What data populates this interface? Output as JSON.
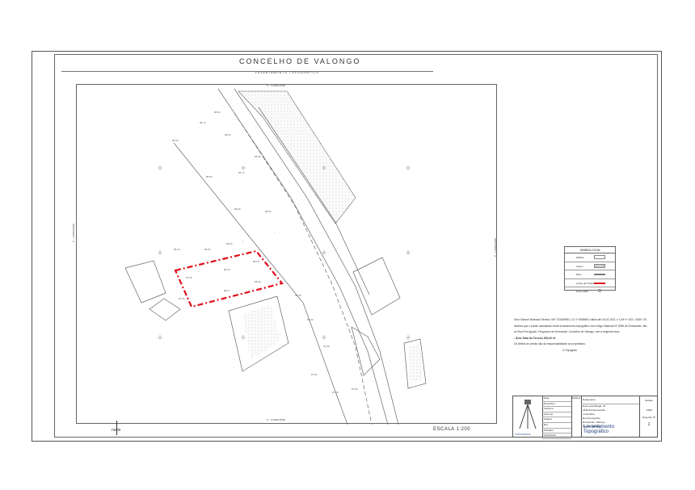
{
  "header": {
    "title": "CONCELHO DE VALONGO",
    "subtitle": "LEVANTAMENTO TOPOGRÁFICO"
  },
  "map": {
    "coord_top": "P - 1 (0000.0000)",
    "coord_bottom": "P - 1 (0000.0000)",
    "coord_left": "P - 1 (0000.0000)",
    "coord_right": "P - 1 (0000.0000)",
    "north_label": "norte",
    "scale_label": "ESCALA 1:200",
    "line_color": "#777777",
    "property_color": "#e0101a"
  },
  "legend": {
    "title": "SIMBOLOGIA",
    "items": [
      {
        "label": "Edifício"
      },
      {
        "label": "Anexo"
      },
      {
        "label": "Muro"
      },
      {
        "label": "Limite de Propriedade"
      },
      {
        "label": "Ponto EDP"
      }
    ]
  },
  "notes": {
    "line1": "Artur Manuel Barbosa Teixeira, NIF 233045984, CC nº 6555891 válido até 04.02.2021, e CAP nº 301 / 3308 / 09,",
    "line2": "declara que o prédio assinalado neste levantamento topográfico com Artigo Matricial Nº 5098 de Ermesinde, situ-",
    "line3": "ao Rua Frei Agosto, Freguesia de Ermesinde, Concelho de Valongo, tem a seguinte área:",
    "line4": "- Área Total do Terreno 200,00 m²",
    "line5": "Os limites do prédio são da responsabilidade do proprietário.",
    "signature": "O Topógrafo"
  },
  "title_block": {
    "logo_label": "TOPOGRAFIA",
    "rows": [
      "Data",
      "Desenhou",
      "Verificou",
      "Aprovou",
      "Arquivo",
      "Ref.",
      "Substitui",
      "Substituído"
    ],
    "col_data": "Data",
    "col_rubrica": "Rubrica",
    "requerente_label": "Requerente",
    "address1": "Rua Lucas Braga, 12",
    "address2": "4445-614 Ermesinde",
    "local_label": "Local Obra",
    "local1": "Rua Frei Agosto",
    "local2": "Ermesinde / Valongo",
    "tipo_label": "Tipo de Trabalho",
    "work_title": "Levantamento Topográfico",
    "escala_label": "Escala",
    "escala_value": "1/200",
    "desenho_label": "Desenho Nº",
    "desenho_value": "1"
  }
}
